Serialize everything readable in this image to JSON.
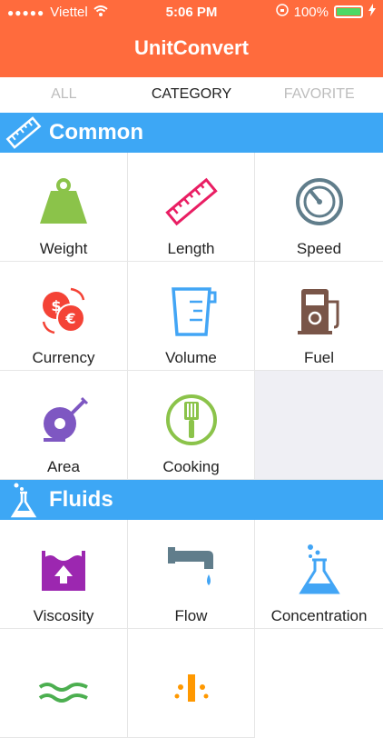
{
  "status": {
    "carrier": "Viettel",
    "time": "5:06 PM",
    "battery": "100%"
  },
  "app": {
    "title": "UnitConvert"
  },
  "tabs": [
    {
      "label": "ALL"
    },
    {
      "label": "CATEGORY"
    },
    {
      "label": "FAVORITE"
    }
  ],
  "sections": [
    {
      "title": "Common",
      "icon": "ruler-icon",
      "items": [
        {
          "label": "Weight",
          "icon": "weight-icon"
        },
        {
          "label": "Length",
          "icon": "ruler-icon"
        },
        {
          "label": "Speed",
          "icon": "speedometer-icon"
        },
        {
          "label": "Currency",
          "icon": "currency-icon"
        },
        {
          "label": "Volume",
          "icon": "measuring-cup-icon"
        },
        {
          "label": "Fuel",
          "icon": "fuel-pump-icon"
        },
        {
          "label": "Area",
          "icon": "tape-measure-icon"
        },
        {
          "label": "Cooking",
          "icon": "spatula-icon"
        }
      ]
    },
    {
      "title": "Fluids",
      "icon": "flask-icon",
      "items": [
        {
          "label": "Viscosity",
          "icon": "viscosity-icon"
        },
        {
          "label": "Flow",
          "icon": "faucet-icon"
        },
        {
          "label": "Concentration",
          "icon": "flask-icon"
        }
      ]
    }
  ],
  "colors": {
    "header": "#FF6B3D",
    "section": "#3DA7F5",
    "green": "#8BC34A",
    "pink": "#E91E63",
    "slate": "#607D8B",
    "red": "#F44336",
    "blue": "#42A5F5",
    "brown": "#795548",
    "purple": "#7E57C2"
  }
}
